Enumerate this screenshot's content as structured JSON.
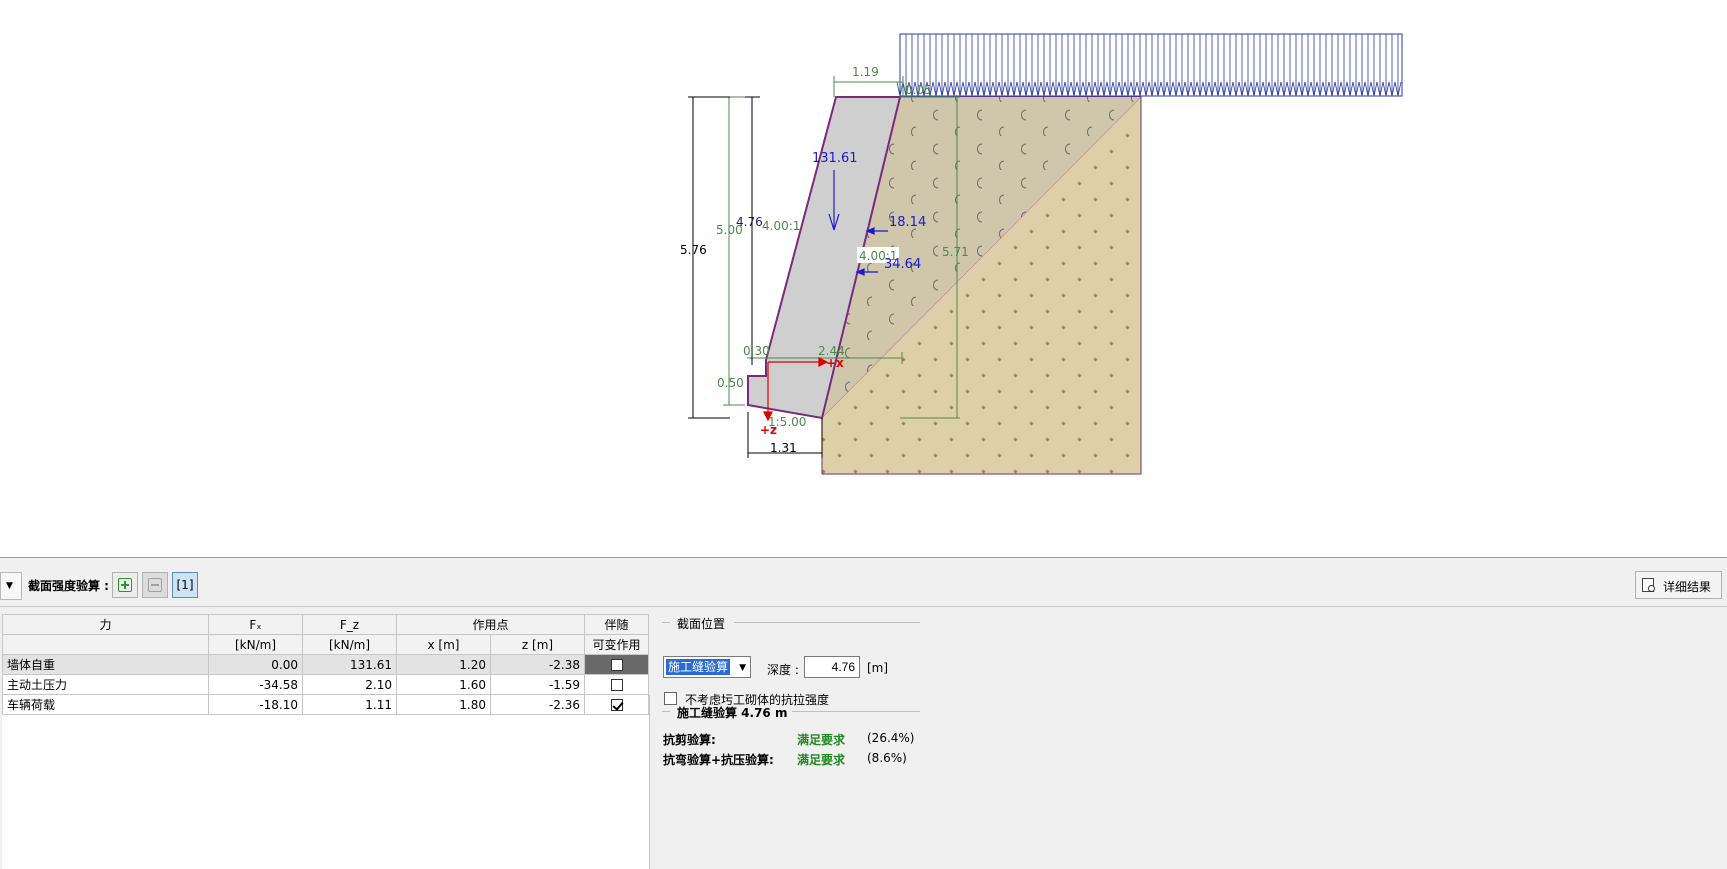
{
  "drawing": {
    "dimensions": {
      "top_width": "1.19",
      "total_height": "5.76",
      "stem_height": "5.00",
      "front_height": "4.76",
      "front_slope": "4.00:1",
      "back_slope": "4.00:1",
      "back_height": "5.71",
      "toe_width": "0.30",
      "heel_width": "2.44",
      "base_thickness": "0.50",
      "base_slope": "1:5.00",
      "base_width": "1.31",
      "surcharge_small": "0.05"
    },
    "forces": {
      "weight": "131.61",
      "surcharge_force": "18.14",
      "earth_pressure": "34.64"
    },
    "axes": {
      "x": "+x",
      "z": "+z"
    }
  },
  "toolbar": {
    "title": "截面强度验算 :",
    "current_tab": "[1]",
    "detail_button": "详细结果"
  },
  "table": {
    "header_force": "力",
    "header_fx": "Fₓ",
    "header_fz": "F_z",
    "header_point": "作用点",
    "header_accompany": "伴随",
    "unit_fx": "[kN/m]",
    "unit_fz": "[kN/m]",
    "header_x": "x [m]",
    "header_z": "z [m]",
    "header_variable": "可变作用",
    "rows": [
      {
        "name": "墙体自重",
        "fx": "0.00",
        "fz": "131.61",
        "x": "1.20",
        "z": "-2.38"
      },
      {
        "name": "主动土压力",
        "fx": "-34.58",
        "fz": "2.10",
        "x": "1.60",
        "z": "-1.59"
      },
      {
        "name": "车辆荷载",
        "fx": "-18.10",
        "fz": "1.11",
        "x": "1.80",
        "z": "-2.36"
      }
    ],
    "checked": [
      false,
      false,
      true
    ]
  },
  "section": {
    "group_title": "截面位置",
    "select_value": "施工缝验算",
    "depth_label": "深度 :",
    "depth_value": "4.76",
    "depth_unit": "[m]",
    "option_label": "不考虑圬工砌体的抗拉强度",
    "result_title": "施工缝验算 4.76 m",
    "results": [
      {
        "label": "抗剪验算:",
        "status": "满足要求",
        "pct": "(26.4%)"
      },
      {
        "label": "抗弯验算+抗压验算:",
        "status": "满足要求",
        "pct": "(8.6%)"
      }
    ]
  },
  "colors": {
    "wall_fill": "#cfcfcf",
    "wall_outline": "#7a2a7a",
    "soil_fill": "#ddd0a8",
    "soil_wedge_fill": "#cfc6ac",
    "dim_green": "#4a8a4a",
    "force_blue": "#1a1ad0",
    "surcharge_blue": "#2a3aa8",
    "ok_green": "#1f8a1f"
  }
}
